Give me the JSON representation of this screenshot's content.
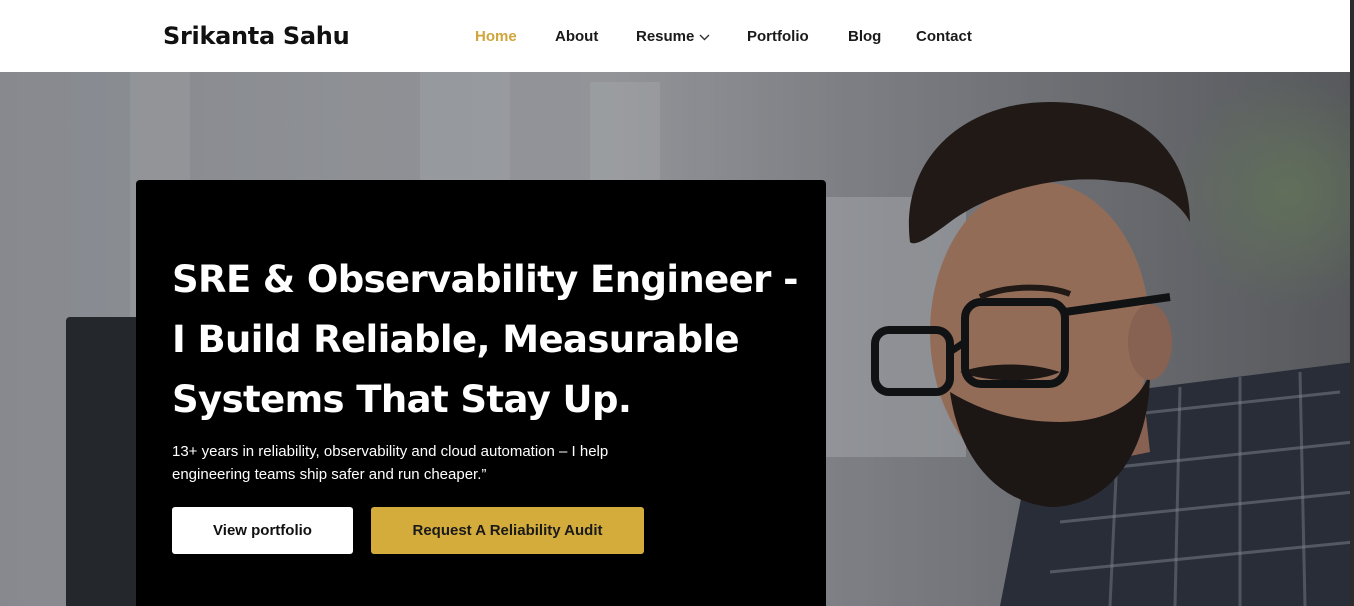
{
  "site": {
    "brand": "Srikanta Sahu"
  },
  "nav": {
    "items": [
      {
        "label": "Home",
        "active": true
      },
      {
        "label": "About",
        "active": false
      },
      {
        "label": "Resume",
        "active": false,
        "has_dropdown": true
      },
      {
        "label": "Portfolio",
        "active": false
      },
      {
        "label": "Blog",
        "active": false
      },
      {
        "label": "Contact",
        "active": false
      }
    ],
    "dropdown_icon": "chevron-down-icon"
  },
  "hero": {
    "headline_line1": "SRE & Observability Engineer -",
    "headline_line2": "I Build Reliable, Measurable",
    "headline_line3": "Systems That Stay Up.",
    "subtext_line1": "13+ years in reliability, observability and cloud automation – I help",
    "subtext_line2": "engineering teams ship safer and run cheaper.”",
    "primary_button": "View portfolio",
    "secondary_button": "Request A Reliability Audit"
  },
  "colors": {
    "accent": "#d4ac3c",
    "nav_active": "#d0a63a",
    "card_bg": "#000000",
    "text_light": "#ffffff",
    "text_dark": "#111111"
  }
}
